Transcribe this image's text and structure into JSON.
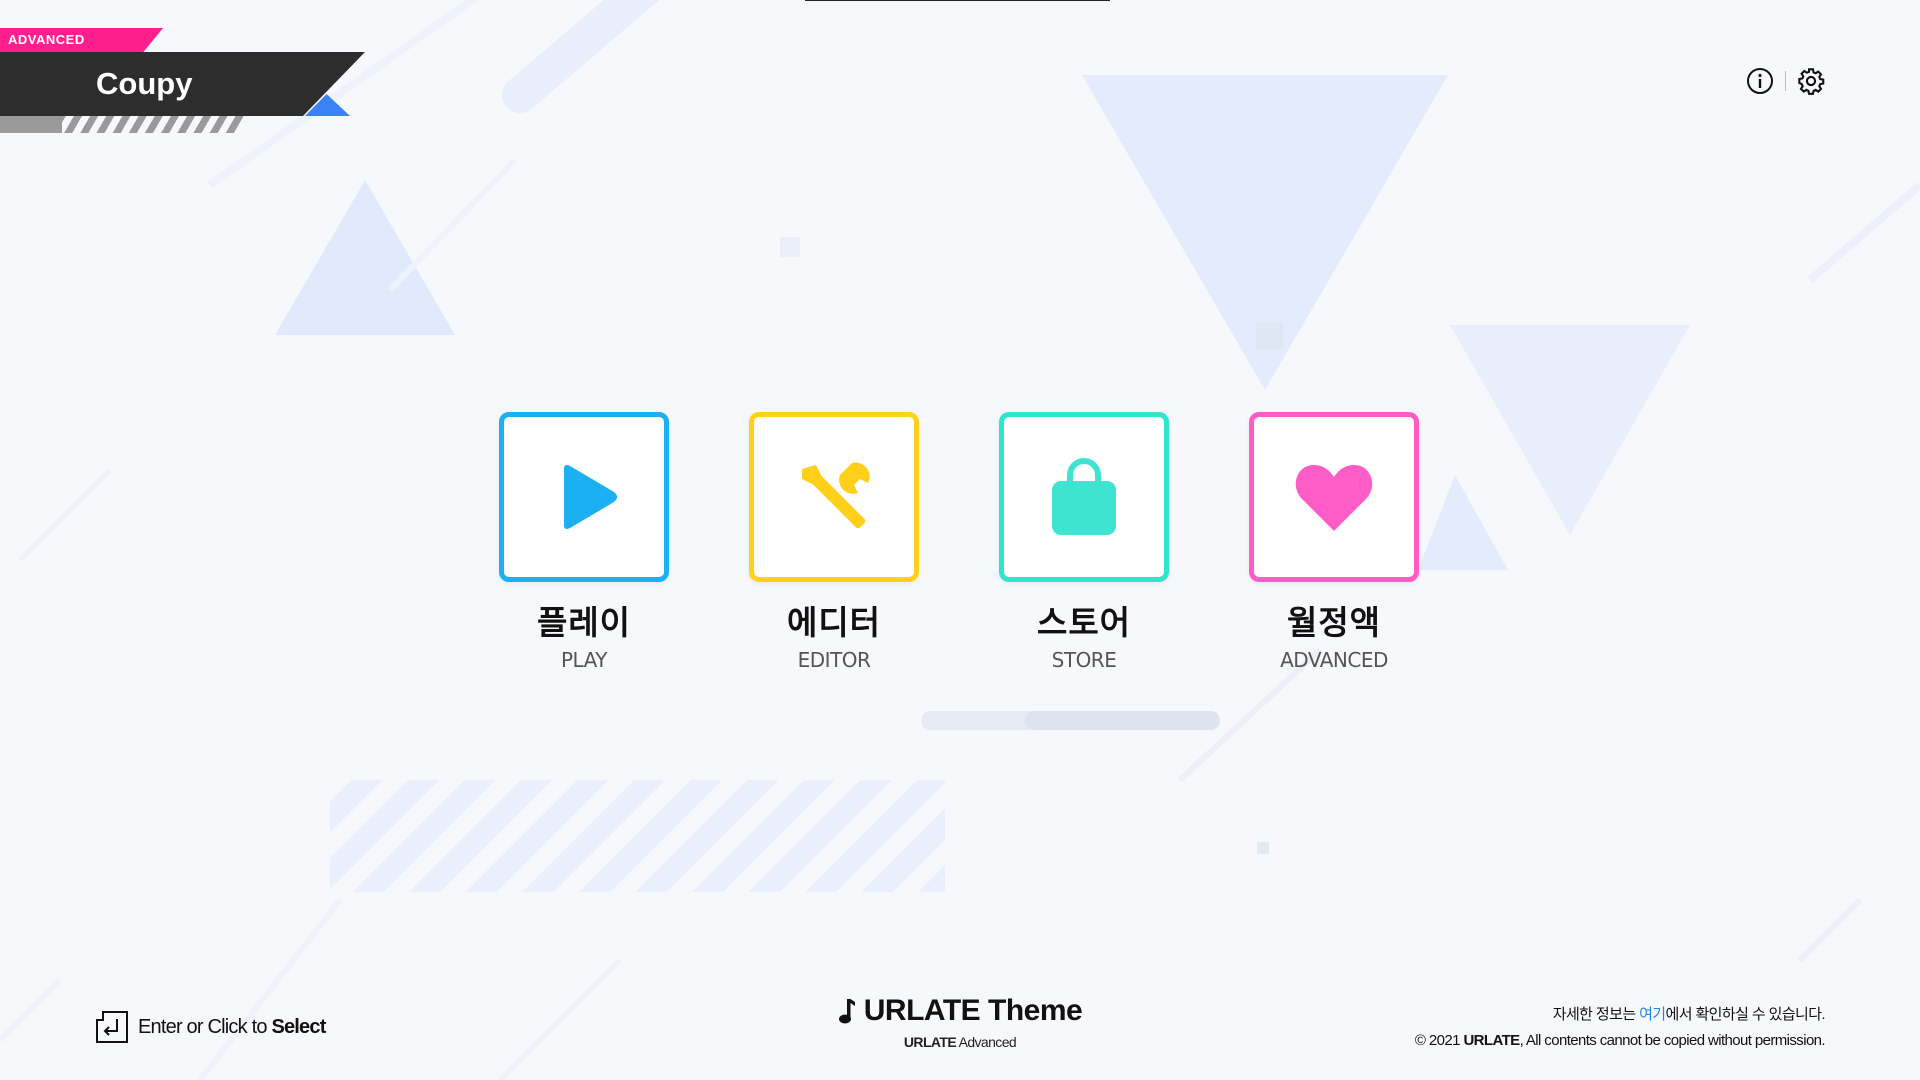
{
  "badge": {
    "tag": "ADVANCED",
    "username": "Coupy"
  },
  "toolbar": {
    "info_icon": "info-circle-icon",
    "settings_icon": "gear-icon"
  },
  "menu": [
    {
      "id": "play",
      "label_kr": "플레이",
      "label_en": "PLAY",
      "color": "#1ab0f2",
      "icon": "play-icon"
    },
    {
      "id": "editor",
      "label_kr": "에디터",
      "label_en": "EDITOR",
      "color": "#ffd21a",
      "icon": "wrench-icon"
    },
    {
      "id": "store",
      "label_kr": "스토어",
      "label_en": "STORE",
      "color": "#2ee6cc",
      "icon": "shopping-bag-icon"
    },
    {
      "id": "advanced",
      "label_kr": "월정액",
      "label_en": "ADVANCED",
      "color": "#ff5cc8",
      "icon": "heart-icon"
    }
  ],
  "footer": {
    "hint_prefix": "Enter or Click to",
    "hint_action": "Select",
    "theme_title": "URLATE Theme",
    "theme_sub_brand": "URLATE",
    "theme_sub_rest": "Advanced",
    "info_prefix": "자세한 정보는 ",
    "info_link": "여기",
    "info_suffix": "에서 확인하실 수 있습니다.",
    "copyright_prefix": "© 2021 ",
    "copyright_brand": "URLATE",
    "copyright_suffix": ", All contents cannot be copied without permission."
  }
}
